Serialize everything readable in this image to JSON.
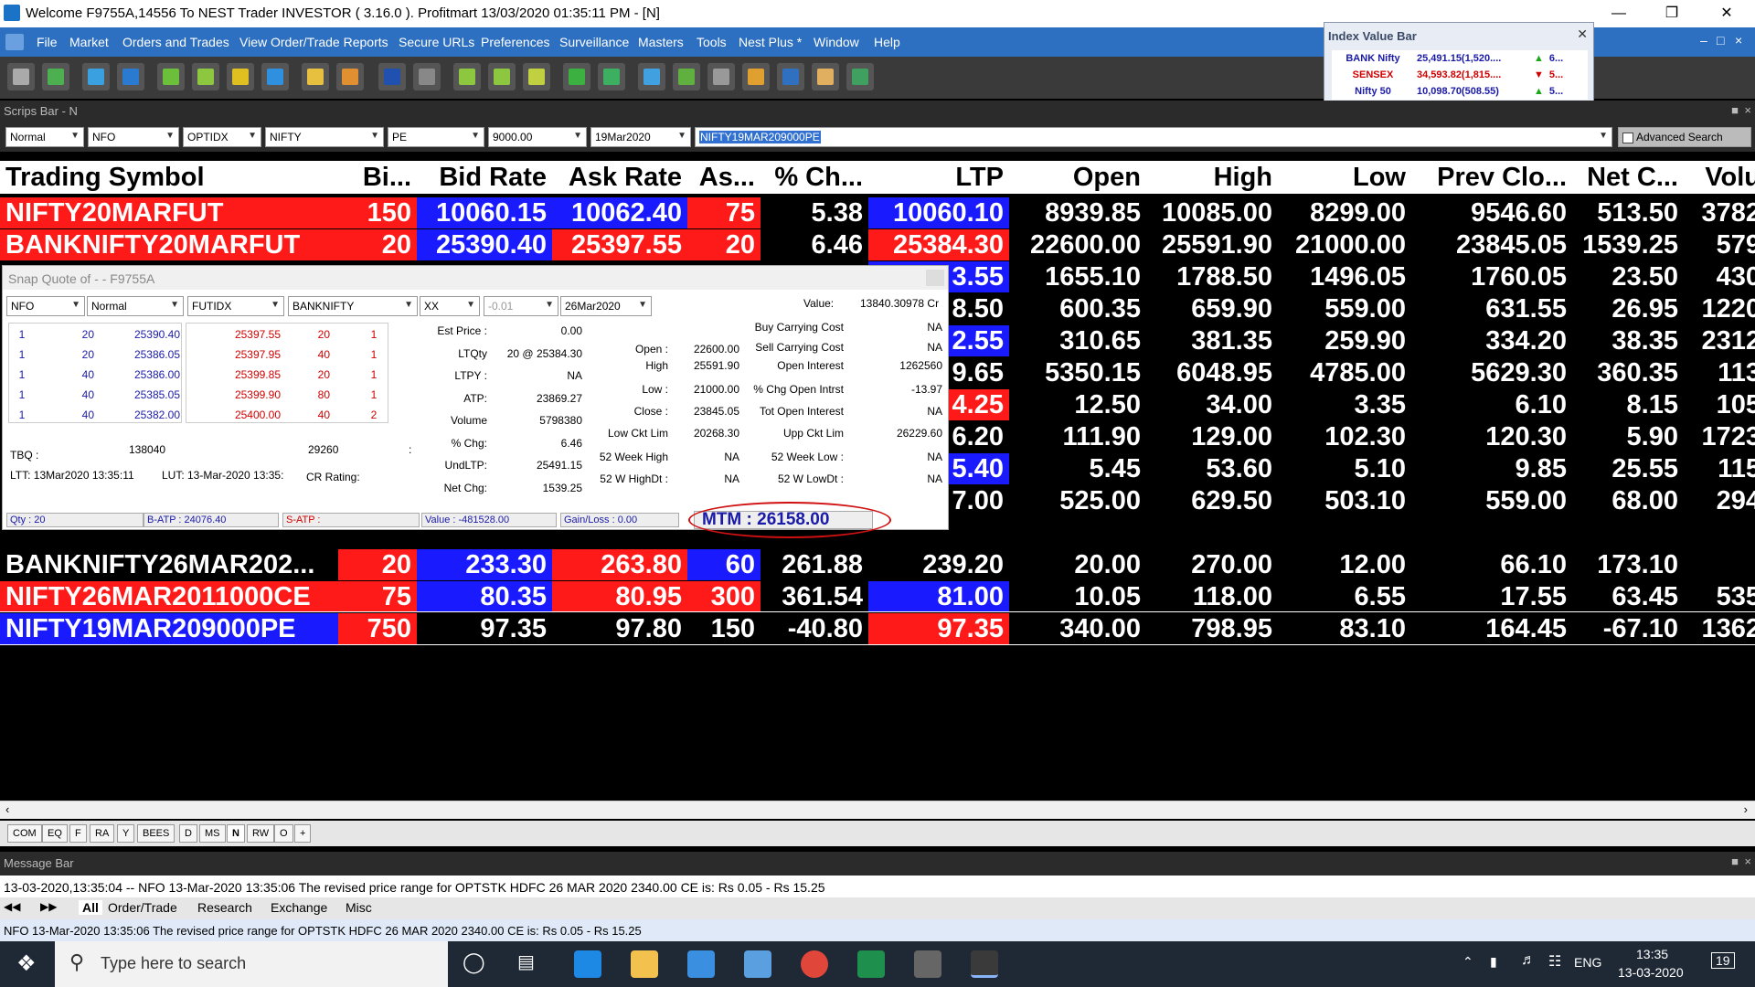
{
  "window": {
    "title": "Welcome F9755A,14556 To NEST Trader INVESTOR ( 3.16.0 ).  Profitmart  13/03/2020  01:35:11 PM - [N]"
  },
  "menu": [
    "File",
    "Market",
    "Orders and Trades",
    "View Order/Trade Reports",
    "Secure URLs",
    "Preferences",
    "Surveillance",
    "Masters",
    "Tools",
    "Nest Plus *",
    "Window",
    "Help"
  ],
  "index_bar": {
    "title": "Index Value Bar",
    "rows": [
      {
        "name": "BANK Nifty",
        "value": "25,491.15(1,520....",
        "dir": "up",
        "more": "6..."
      },
      {
        "name": "SENSEX",
        "value": "34,593.82(1,815....",
        "dir": "down",
        "more": "5..."
      },
      {
        "name": "Nifty 50",
        "value": "10,098.70(508.55)",
        "dir": "up",
        "more": "5..."
      }
    ]
  },
  "scrips_bar": {
    "label": "Scrips Bar - N",
    "fields": [
      "Normal",
      "NFO",
      "OPTIDX",
      "NIFTY",
      "PE",
      "9000.00",
      "19Mar2020"
    ],
    "symbol": "NIFTY19MAR209000PE",
    "advanced": "Advanced Search"
  },
  "market_watch": {
    "headers": [
      "Trading Symbol",
      "Bi...",
      "Bid Rate",
      "Ask Rate",
      "As...",
      "% Ch...",
      "LTP",
      "Open",
      "High",
      "Low",
      "Prev Clo...",
      "Net C...",
      "Volu"
    ],
    "rows": [
      [
        "NIFTY20MARFUT",
        "150",
        "10060.15",
        "10062.40",
        "75",
        "5.38",
        "10060.10",
        "8939.85",
        "10085.00",
        "8299.00",
        "9546.60",
        "513.50",
        "3782"
      ],
      [
        "BANKNIFTY20MARFUT",
        "20",
        "25390.40",
        "25397.55",
        "20",
        "6.46",
        "25384.30",
        "22600.00",
        "25591.90",
        "21000.00",
        "23845.05",
        "1539.25",
        "579"
      ],
      [
        "",
        "",
        "",
        "",
        "",
        "",
        "3.55",
        "1655.10",
        "1788.50",
        "1496.05",
        "1760.05",
        "23.50",
        "430"
      ],
      [
        "",
        "",
        "",
        "",
        "",
        "",
        "8.50",
        "600.35",
        "659.90",
        "559.00",
        "631.55",
        "26.95",
        "1220"
      ],
      [
        "",
        "",
        "",
        "",
        "",
        "",
        "2.55",
        "310.65",
        "381.35",
        "259.90",
        "334.20",
        "38.35",
        "2312"
      ],
      [
        "",
        "",
        "",
        "",
        "",
        "",
        "9.65",
        "5350.15",
        "6048.95",
        "4785.00",
        "5629.30",
        "360.35",
        "113"
      ],
      [
        "",
        "",
        "",
        "",
        "",
        "",
        "4.25",
        "12.50",
        "34.00",
        "3.35",
        "6.10",
        "8.15",
        "105"
      ],
      [
        "",
        "",
        "",
        "",
        "",
        "",
        "6.20",
        "111.90",
        "129.00",
        "102.30",
        "120.30",
        "5.90",
        "1723"
      ],
      [
        "",
        "",
        "",
        "",
        "",
        "",
        "5.40",
        "5.45",
        "53.60",
        "5.10",
        "9.85",
        "25.55",
        "115"
      ],
      [
        "",
        "",
        "",
        "",
        "",
        "",
        "7.00",
        "525.00",
        "629.50",
        "503.10",
        "559.00",
        "68.00",
        "294"
      ],
      [
        "",
        "",
        "",
        "",
        "",
        "",
        "",
        "",
        "",
        "",
        "",
        "",
        ""
      ],
      [
        "BANKNIFTY26MAR202...",
        "20",
        "233.30",
        "263.80",
        "60",
        "261.88",
        "239.20",
        "20.00",
        "270.00",
        "12.00",
        "66.10",
        "173.10",
        ""
      ],
      [
        "NIFTY26MAR2011000CE",
        "75",
        "80.35",
        "80.95",
        "300",
        "361.54",
        "81.00",
        "10.05",
        "118.00",
        "6.55",
        "17.55",
        "63.45",
        "535"
      ],
      [
        "NIFTY19MAR209000PE",
        "750",
        "97.35",
        "97.80",
        "150",
        "-40.80",
        "97.35",
        "340.00",
        "798.95",
        "83.10",
        "164.45",
        "-67.10",
        "1362"
      ]
    ]
  },
  "snap_quote": {
    "title": "Snap Quote of   -  - F9755A",
    "fields": [
      "NFO",
      "Normal",
      "FUTIDX",
      "BANKNIFTY",
      "XX",
      "-0.01",
      "26Mar2020"
    ],
    "value_label": "Value:",
    "value": "13840.30978 Cr",
    "bids": [
      [
        "1",
        "20",
        "25390.40"
      ],
      [
        "1",
        "20",
        "25386.05"
      ],
      [
        "1",
        "40",
        "25386.00"
      ],
      [
        "1",
        "40",
        "25385.05"
      ],
      [
        "1",
        "40",
        "25382.00"
      ]
    ],
    "asks": [
      [
        "25397.55",
        "20",
        "1"
      ],
      [
        "25397.95",
        "40",
        "1"
      ],
      [
        "25399.85",
        "20",
        "1"
      ],
      [
        "25399.90",
        "80",
        "1"
      ],
      [
        "25400.00",
        "40",
        "2"
      ]
    ],
    "tbq_label": "TBQ :",
    "tbq": "138040",
    "tsq": "29260",
    "colon": ":",
    "ltt": "LTT:  13Mar2020 13:35:11",
    "lut": "LUT:  13-Mar-2020 13:35:",
    "cr_rating": "CR Rating:",
    "mid": [
      [
        "Est Price :",
        "0.00"
      ],
      [
        "LTQty",
        "20 @ 25384.30"
      ],
      [
        "LTPY :",
        "NA"
      ],
      [
        "ATP:",
        "23869.27"
      ],
      [
        "Volume",
        "5798380"
      ],
      [
        "% Chg:",
        "6.46"
      ],
      [
        "UndLTP:",
        "25491.15"
      ],
      [
        "Net Chg:",
        "1539.25"
      ]
    ],
    "right1": [
      [
        "Open :",
        "22600.00"
      ],
      [
        "High",
        "25591.90"
      ],
      [
        "Low :",
        "21000.00"
      ],
      [
        "Close :",
        "23845.05"
      ],
      [
        "Low Ckt Lim",
        "20268.30"
      ],
      [
        "52 Week High",
        "NA"
      ],
      [
        "52 W HighDt :",
        "NA"
      ]
    ],
    "right2": [
      [
        "Buy Carrying Cost",
        "NA"
      ],
      [
        "Sell Carrying Cost",
        "NA"
      ],
      [
        "Open Interest",
        "1262560"
      ],
      [
        "% Chg Open Intrst",
        "-13.97"
      ],
      [
        "Tot Open Interest",
        "NA"
      ],
      [
        "Upp Ckt Lim",
        "26229.60"
      ],
      [
        "52 Week Low :",
        "NA"
      ],
      [
        "52 W LowDt :",
        "NA"
      ]
    ],
    "footer": [
      "Qty : 20",
      "B-ATP : 24076.40",
      "S-ATP :",
      "Value : -481528.00",
      "Gain/Loss : 0.00"
    ],
    "mtm": "MTM : 26158.00"
  },
  "tabs": [
    "COM",
    "EQ",
    "F",
    "RA",
    "Y",
    "BEES",
    "D",
    "MS",
    "N",
    "RW",
    "O",
    "+"
  ],
  "message_bar": {
    "label": "Message Bar",
    "line": "13-03-2020,13:35:04  -- NFO 13-Mar-2020 13:35:06 The revised price range for OPTSTK HDFC 26 MAR 2020 2340.00 CE is: Rs 0.05 - Rs 15.25",
    "tabs": [
      "All",
      "Order/Trade",
      "Research",
      "Exchange",
      "Misc"
    ],
    "status": "NFO 13-Mar-2020 13:35:06 The revised price range for OPTSTK HDFC 26 MAR 2020 2340.00 CE is: Rs 0.05 - Rs 15.25"
  },
  "taskbar": {
    "search": "Type here to search",
    "lang": "ENG",
    "time": "13:35",
    "date": "13-03-2020",
    "notif": "19"
  }
}
